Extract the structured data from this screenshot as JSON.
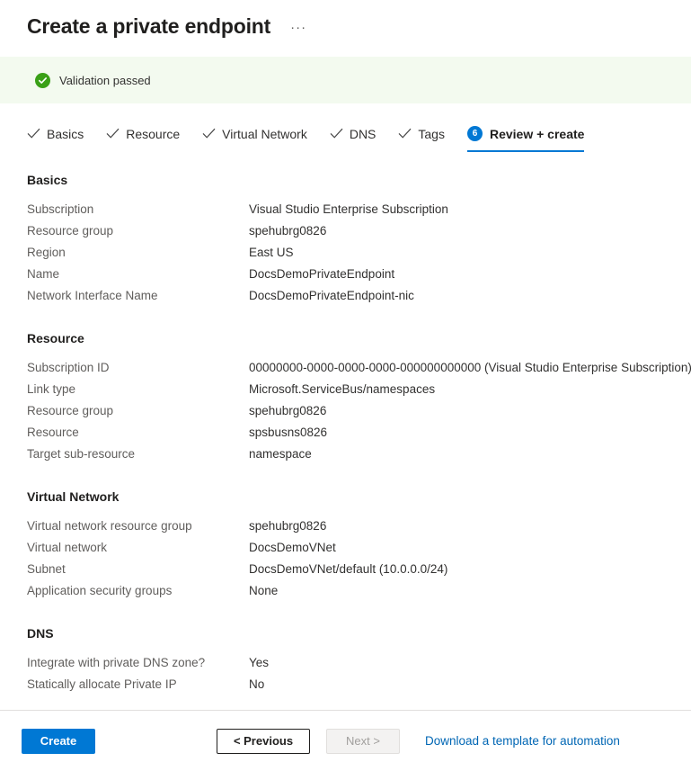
{
  "header": {
    "title": "Create a private endpoint",
    "more_label": "···"
  },
  "validation": {
    "icon": "check-circle-icon",
    "message": "Validation passed",
    "background_color": "#f3faef",
    "icon_color": "#3aa017"
  },
  "tabs": [
    {
      "label": "Basics",
      "state": "completed",
      "icon": "check-icon"
    },
    {
      "label": "Resource",
      "state": "completed",
      "icon": "check-icon"
    },
    {
      "label": "Virtual Network",
      "state": "completed",
      "icon": "check-icon"
    },
    {
      "label": "DNS",
      "state": "completed",
      "icon": "check-icon"
    },
    {
      "label": "Tags",
      "state": "completed",
      "icon": "check-icon"
    },
    {
      "label": "Review + create",
      "state": "active",
      "badge": "6"
    }
  ],
  "sections": [
    {
      "title": "Basics",
      "rows": [
        {
          "label": "Subscription",
          "value": "Visual Studio Enterprise Subscription"
        },
        {
          "label": "Resource group",
          "value": "spehubrg0826"
        },
        {
          "label": "Region",
          "value": "East US"
        },
        {
          "label": "Name",
          "value": "DocsDemoPrivateEndpoint"
        },
        {
          "label": "Network Interface Name",
          "value": "DocsDemoPrivateEndpoint-nic"
        }
      ]
    },
    {
      "title": "Resource",
      "rows": [
        {
          "label": "Subscription ID",
          "value": "00000000-0000-0000-0000-000000000000 (Visual Studio Enterprise Subscription)"
        },
        {
          "label": "Link type",
          "value": "Microsoft.ServiceBus/namespaces"
        },
        {
          "label": "Resource group",
          "value": "spehubrg0826"
        },
        {
          "label": "Resource",
          "value": "spsbusns0826"
        },
        {
          "label": "Target sub-resource",
          "value": "namespace"
        }
      ]
    },
    {
      "title": "Virtual Network",
      "rows": [
        {
          "label": "Virtual network resource group",
          "value": "spehubrg0826"
        },
        {
          "label": "Virtual network",
          "value": "DocsDemoVNet"
        },
        {
          "label": "Subnet",
          "value": "DocsDemoVNet/default (10.0.0.0/24)"
        },
        {
          "label": "Application security groups",
          "value": "None"
        }
      ]
    },
    {
      "title": "DNS",
      "rows": [
        {
          "label": "Integrate with private DNS zone?",
          "value": "Yes"
        },
        {
          "label": "Statically allocate Private IP",
          "value": "No"
        }
      ]
    }
  ],
  "footer": {
    "create_label": "Create",
    "previous_label": "< Previous",
    "next_label": "Next >",
    "template_link_label": "Download a template for automation",
    "accent_color": "#0078d4",
    "link_color": "#0066b4"
  }
}
